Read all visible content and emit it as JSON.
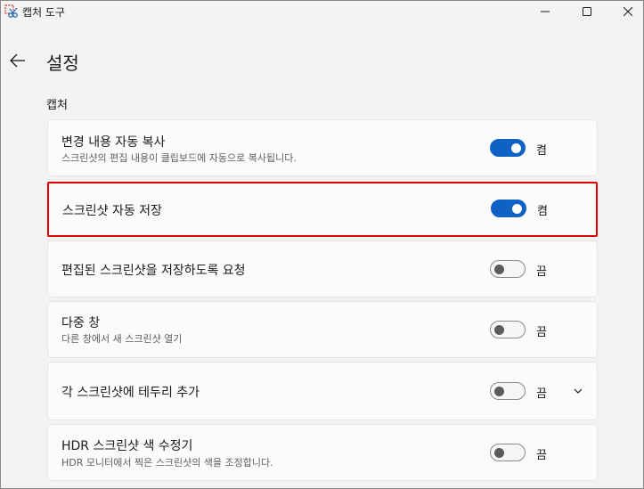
{
  "window": {
    "title": "캡처 도구",
    "controls": [
      "minimize",
      "maximize",
      "close"
    ]
  },
  "page": {
    "title": "설정",
    "back_icon": "arrow-left-icon"
  },
  "section": {
    "label": "캡처"
  },
  "settings": [
    {
      "title": "변경 내용 자동 복사",
      "description": "스크린샷의 편집 내용이 클립보드에 자동으로 복사됩니다.",
      "state": "켬",
      "on": true,
      "highlighted": false,
      "expandable": false
    },
    {
      "title": "스크린샷 자동 저장",
      "description": "",
      "state": "켬",
      "on": true,
      "highlighted": true,
      "expandable": false
    },
    {
      "title": "편집된 스크린샷을 저장하도록 요청",
      "description": "",
      "state": "끔",
      "on": false,
      "highlighted": false,
      "expandable": false
    },
    {
      "title": "다중 창",
      "description": "다른 창에서 새 스크린샷 열기",
      "state": "끔",
      "on": false,
      "highlighted": false,
      "expandable": false
    },
    {
      "title": "각 스크린샷에 테두리 추가",
      "description": "",
      "state": "끔",
      "on": false,
      "highlighted": false,
      "expandable": true
    },
    {
      "title": "HDR 스크린샷 색 수정기",
      "description": "HDR 모니터에서 찍은 스크린샷의 색을 조정합니다.",
      "state": "끔",
      "on": false,
      "highlighted": false,
      "expandable": false
    }
  ],
  "colors": {
    "accent": "#0f62c4",
    "highlight_border": "#e00000",
    "background": "#f3f3f3",
    "card": "#fbfbfb"
  }
}
